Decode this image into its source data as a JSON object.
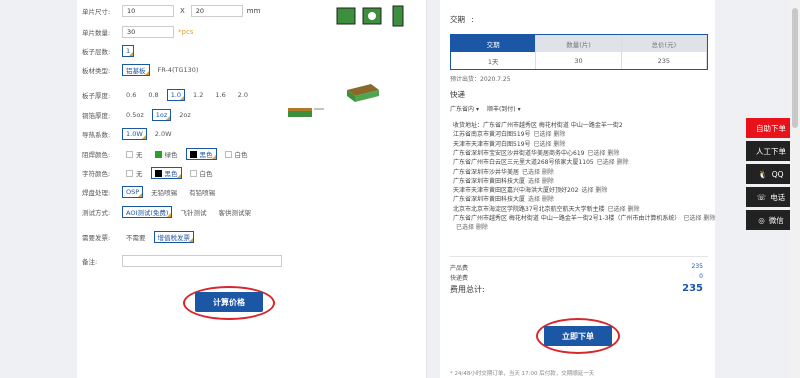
{
  "form": {
    "size": {
      "label": "单片尺寸:",
      "w": "10",
      "sep": "X",
      "h": "20",
      "unit": "mm"
    },
    "qty": {
      "label": "单片数量:",
      "value": "30",
      "unit": "*pcs"
    },
    "layers": {
      "label": "板子层数:",
      "value": "1"
    },
    "material": {
      "label": "板材类型:",
      "options": [
        "铝基板",
        "FR-4(TG130)"
      ]
    },
    "thickness": {
      "label": "板子厚度:",
      "options": [
        "0.6",
        "0.8",
        "1.0",
        "1.2",
        "1.6",
        "2.0"
      ]
    },
    "copper": {
      "label": "铜箔厚度:",
      "options": [
        "0.5oz",
        "1oz",
        "2oz"
      ]
    },
    "thermal": {
      "label": "导热系数:",
      "options": [
        "1.0W",
        "2.0W"
      ]
    },
    "mask": {
      "label": "阻焊颜色:",
      "options": [
        "无",
        "绿色",
        "黑色",
        "白色"
      ]
    },
    "silk": {
      "label": "字符颜色:",
      "options": [
        "无",
        "黑色",
        "白色"
      ]
    },
    "finish": {
      "label": "焊盘处理:",
      "options": [
        "OSP",
        "无铅喷锡",
        "有铅喷锡"
      ]
    },
    "test": {
      "label": "测试方式:",
      "options": [
        "AOI测试(免费)",
        "飞针测试",
        "客供测试架"
      ]
    },
    "invoice": {
      "label": "需要发票:",
      "options": [
        "不需要",
        "增值税发票"
      ]
    },
    "note": {
      "label": "备注:",
      "value": ""
    },
    "calc_button": "计算价格"
  },
  "delivery": {
    "title": "交期",
    "colon": ":",
    "headers": [
      "交期",
      "数量(片)",
      "总价(元)"
    ],
    "row": [
      "1天",
      "30",
      "235"
    ],
    "estimate": "预计出货：2020.7.25"
  },
  "shipping": {
    "title": "快递",
    "region": "广东省内",
    "carrier": "顺丰(到付)",
    "addresses": [
      {
        "text": "收货地址：广东省广州市越秀区 梅花村街道 中山一路金羊一街2",
        "actions": ""
      },
      {
        "text": "江苏省南京市黄河白图519号",
        "actions": "已选择  删除"
      },
      {
        "text": "天津市天津市黄河白图519号",
        "actions": "已选择  删除"
      },
      {
        "text": "广东省深圳市宝安区沙井街道华美居商务中心619",
        "actions": "已选择  删除"
      },
      {
        "text": "广东省广州市白云区三元里大道268号依家大厦1105",
        "actions": "已选择  删除"
      },
      {
        "text": "广东省深圳市沙井华美居",
        "actions": "已选择  删除"
      },
      {
        "text": "广东省深圳市黄田科技大厦",
        "actions": "选择  删除"
      },
      {
        "text": "天津市天津市黄田区嘉兴中海洪大厦好顶好202",
        "actions": "选择  删除"
      },
      {
        "text": "广东省深圳市黄田科技大厦",
        "actions": "选择  删除"
      },
      {
        "text": "北京市北京市海淀区学院路37号北京航空航天大学新主楼",
        "actions": "已选择  删除"
      },
      {
        "text": "广东省广州市越秀区 梅花村街道 中山一路金羊一街2号1-3楼（广州市由计算机系统）",
        "actions": "已选择  删除"
      },
      {
        "text": "",
        "actions": "已选择  删除"
      }
    ]
  },
  "costs": {
    "product_label": "产品费",
    "product_value": "235",
    "ship_label": "快递费",
    "ship_value": "0",
    "total_label": "费用总计:",
    "total_value": "235"
  },
  "order_button": "立即下单",
  "footnote": "* 24/48小时交期订单，当天 17:00 后付款，交期顺延一天",
  "float_menu": [
    "自助下单",
    "人工下单",
    "QQ",
    "电话",
    "微信"
  ],
  "colors": {
    "brand_blue": "#1c57a6",
    "accent_red": "#d8262a"
  }
}
